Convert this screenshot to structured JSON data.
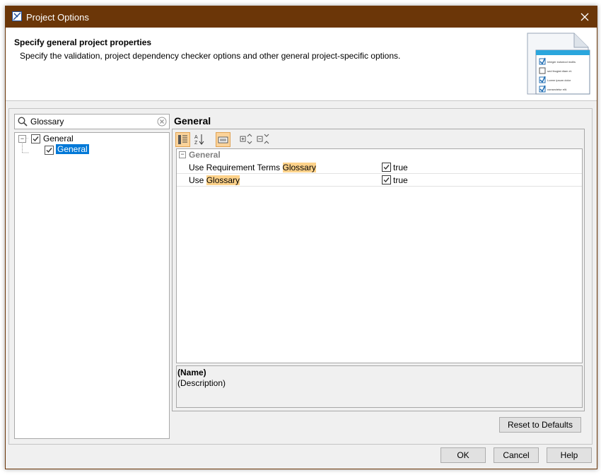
{
  "window": {
    "title": "Project Options"
  },
  "header": {
    "title": "Specify general project properties",
    "description": "Specify the validation, project dependency checker options and other general project-specific options.",
    "illustration_lines": [
      "Integer euismod mollis",
      "sed feugiat diam et.",
      "Lorem ipsum dolor",
      "consectetur elit."
    ]
  },
  "search": {
    "value": "Glossary",
    "placeholder": ""
  },
  "tree": {
    "root": {
      "label": "General",
      "checked": true
    },
    "child": {
      "label": "General",
      "checked": true,
      "selected": true
    }
  },
  "panel": {
    "title": "General"
  },
  "toolbar": {
    "buttons": [
      "categorized-view-icon",
      "sort-alphabetically-icon",
      "show-description-icon",
      "expand-all-icon",
      "collapse-all-icon"
    ]
  },
  "properties": {
    "group": "General",
    "rows": [
      {
        "name_prefix": "Use Requirement Terms ",
        "name_highlight": "Glossary",
        "value": "true"
      },
      {
        "name_prefix": "Use ",
        "name_highlight": "Glossary",
        "value": "true"
      }
    ]
  },
  "description": {
    "name": "(Name)",
    "text": "(Description)"
  },
  "buttons": {
    "reset": "Reset to Defaults",
    "ok": "OK",
    "cancel": "Cancel",
    "help": "Help"
  },
  "colors": {
    "titlebar": "#6b3608",
    "selection": "#0078d7",
    "highlight": "#fdd28a"
  }
}
